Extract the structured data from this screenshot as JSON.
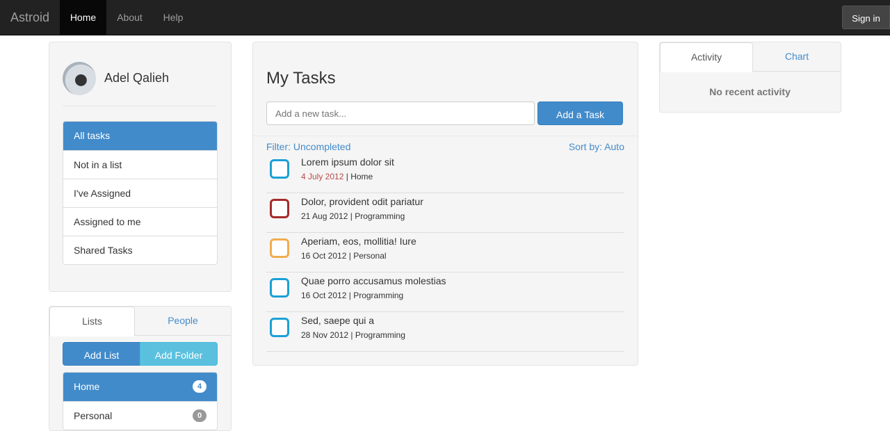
{
  "navbar": {
    "brand": "Astroid",
    "items": [
      {
        "label": "Home"
      },
      {
        "label": "About"
      },
      {
        "label": "Help"
      }
    ],
    "signin_label": "Sign in"
  },
  "profile": {
    "name": "Adel Qalieh"
  },
  "filters": {
    "items": [
      {
        "label": "All tasks"
      },
      {
        "label": "Not in a list"
      },
      {
        "label": "I've Assigned"
      },
      {
        "label": "Assigned to me"
      },
      {
        "label": "Shared Tasks"
      }
    ]
  },
  "lists_panel": {
    "tabs": [
      {
        "label": "Lists"
      },
      {
        "label": "People"
      }
    ],
    "add_list_label": "Add List",
    "add_folder_label": "Add Folder",
    "lists": [
      {
        "label": "Home",
        "count": "4"
      },
      {
        "label": "Personal",
        "count": "0"
      }
    ]
  },
  "main": {
    "title": "My Tasks",
    "new_task_placeholder": "Add a new task...",
    "add_task_label": "Add a Task",
    "filter_label": "Filter: Uncompleted",
    "sort_label": "Sort by: Auto",
    "tasks": [
      {
        "title": "Lorem ipsum dolor sit",
        "date": "4 July 2012",
        "list": "Home",
        "color": "#1ba0d6",
        "overdue": true
      },
      {
        "title": "Dolor, provident odit pariatur",
        "date": "21 Aug 2012",
        "list": "Programming",
        "color": "#a52a2a",
        "overdue": false
      },
      {
        "title": "Aperiam, eos, mollitia! Iure",
        "date": "16 Oct 2012",
        "list": "Personal",
        "color": "#f0ad4e",
        "overdue": false
      },
      {
        "title": "Quae porro accusamus molestias",
        "date": "16 Oct 2012",
        "list": "Programming",
        "color": "#1ba0d6",
        "overdue": false
      },
      {
        "title": "Sed, saepe qui a",
        "date": "28 Nov 2012",
        "list": "Programming",
        "color": "#1ba0d6",
        "overdue": false
      }
    ],
    "separator": "|"
  },
  "activity_panel": {
    "tabs": [
      {
        "label": "Activity"
      },
      {
        "label": "Chart"
      }
    ],
    "empty_text": "No recent activity"
  },
  "colors": {
    "primary": "#428bca",
    "info": "#5bc0de",
    "navbar": "#222222",
    "overdue": "#b94a48"
  }
}
